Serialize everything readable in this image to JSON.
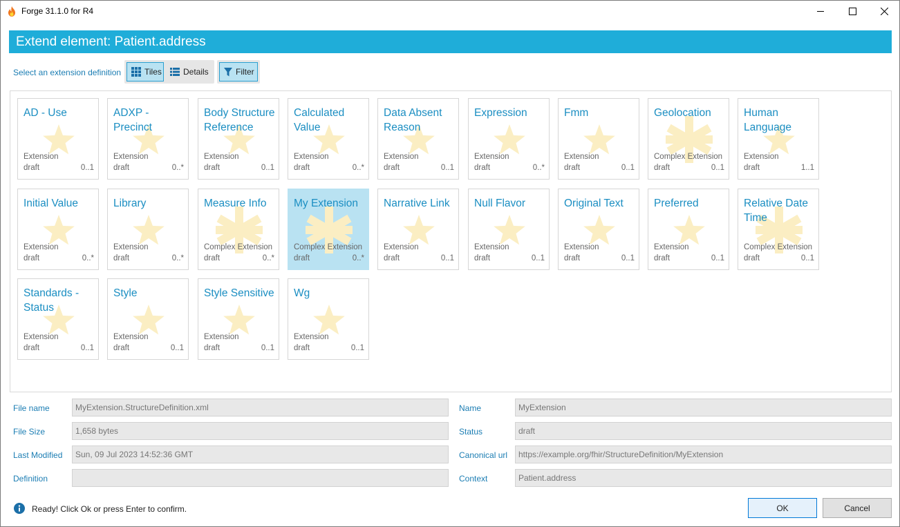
{
  "window": {
    "title": "Forge 31.1.0 for R4",
    "controls": [
      "minimize-icon",
      "maximize-icon",
      "close-icon"
    ]
  },
  "dialog": {
    "heading": "Extend element: Patient.address"
  },
  "toolbar": {
    "select_label": "Select an extension definition",
    "tiles_label": "Tiles",
    "details_label": "Details",
    "filter_label": "Filter",
    "tiles_active": true,
    "details_active": false,
    "filter_active": true
  },
  "colors": {
    "accent": "#1fadd9",
    "selected_tile": "#b9e2f2",
    "link_text": "#1b8ec2",
    "star": "#fbeec3"
  },
  "tiles": [
    {
      "name": "AD - Use",
      "type": "Extension",
      "status": "draft",
      "cardinality": "0..1",
      "icon": "star-icon"
    },
    {
      "name": "ADXP - Precinct",
      "type": "Extension",
      "status": "draft",
      "cardinality": "0..*",
      "icon": "star-icon"
    },
    {
      "name": "Body Structure Reference",
      "type": "Extension",
      "status": "draft",
      "cardinality": "0..1",
      "icon": "star-icon"
    },
    {
      "name": "Calculated Value",
      "type": "Extension",
      "status": "draft",
      "cardinality": "0..*",
      "icon": "star-icon"
    },
    {
      "name": "Data Absent Reason",
      "type": "Extension",
      "status": "draft",
      "cardinality": "0..1",
      "icon": "star-icon"
    },
    {
      "name": "Expression",
      "type": "Extension",
      "status": "draft",
      "cardinality": "0..*",
      "icon": "star-icon"
    },
    {
      "name": "Fmm",
      "type": "Extension",
      "status": "draft",
      "cardinality": "0..1",
      "icon": "star-icon"
    },
    {
      "name": "Geolocation",
      "type": "Complex Extension",
      "status": "draft",
      "cardinality": "0..1",
      "icon": "asterisk-icon"
    },
    {
      "name": "Human Language",
      "type": "Extension",
      "status": "draft",
      "cardinality": "1..1",
      "icon": "star-icon"
    },
    {
      "name": "Initial Value",
      "type": "Extension",
      "status": "draft",
      "cardinality": "0..*",
      "icon": "star-icon"
    },
    {
      "name": "Library",
      "type": "Extension",
      "status": "draft",
      "cardinality": "0..*",
      "icon": "star-icon"
    },
    {
      "name": "Measure Info",
      "type": "Complex Extension",
      "status": "draft",
      "cardinality": "0..*",
      "icon": "asterisk-icon"
    },
    {
      "name": "My Extension",
      "type": "Complex Extension",
      "status": "draft",
      "cardinality": "0..*",
      "icon": "asterisk-icon",
      "selected": true
    },
    {
      "name": "Narrative Link",
      "type": "Extension",
      "status": "draft",
      "cardinality": "0..1",
      "icon": "star-icon"
    },
    {
      "name": "Null Flavor",
      "type": "Extension",
      "status": "draft",
      "cardinality": "0..1",
      "icon": "star-icon"
    },
    {
      "name": "Original Text",
      "type": "Extension",
      "status": "draft",
      "cardinality": "0..1",
      "icon": "star-icon"
    },
    {
      "name": "Preferred",
      "type": "Extension",
      "status": "draft",
      "cardinality": "0..1",
      "icon": "star-icon"
    },
    {
      "name": "Relative Date Time",
      "type": "Complex Extension",
      "status": "draft",
      "cardinality": "0..1",
      "icon": "asterisk-icon"
    },
    {
      "name": "Standards - Status",
      "type": "Extension",
      "status": "draft",
      "cardinality": "0..1",
      "icon": "star-icon"
    },
    {
      "name": "Style",
      "type": "Extension",
      "status": "draft",
      "cardinality": "0..1",
      "icon": "star-icon"
    },
    {
      "name": "Style Sensitive",
      "type": "Extension",
      "status": "draft",
      "cardinality": "0..1",
      "icon": "star-icon"
    },
    {
      "name": "Wg",
      "type": "Extension",
      "status": "draft",
      "cardinality": "0..1",
      "icon": "star-icon"
    }
  ],
  "details": {
    "file_name_label": "File name",
    "file_name_value": "MyExtension.StructureDefinition.xml",
    "file_size_label": "File Size",
    "file_size_value": "1,658 bytes",
    "last_modified_label": "Last Modified",
    "last_modified_value": "Sun, 09 Jul 2023 14:52:36 GMT",
    "definition_label": "Definition",
    "definition_value": "",
    "name_label": "Name",
    "name_value": "MyExtension",
    "status_label": "Status",
    "status_value": "draft",
    "canonical_label": "Canonical url",
    "canonical_value": "https://example.org/fhir/StructureDefinition/MyExtension",
    "context_label": "Context",
    "context_value": "Patient.address"
  },
  "footer": {
    "status_message": "Ready! Click Ok or press Enter to confirm.",
    "ok_label": "OK",
    "cancel_label": "Cancel"
  }
}
